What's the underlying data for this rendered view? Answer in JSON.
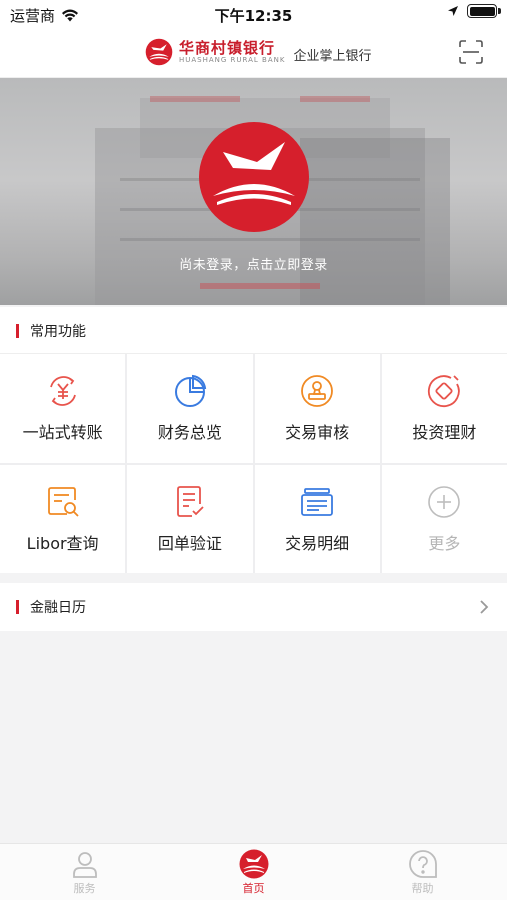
{
  "status_bar": {
    "carrier": "运营商",
    "time": "下午12:35"
  },
  "header": {
    "brand_cn": "华商村镇银行",
    "brand_en": "HUASHANG RURAL BANK",
    "subtitle": "企业掌上银行",
    "scan_icon": "scan-icon"
  },
  "banner": {
    "login_prompt": "尚未登录，点击立即登录"
  },
  "common_functions": {
    "title": "常用功能",
    "items": [
      {
        "label": "一站式转账",
        "icon": "transfer-icon",
        "color": "#e8544c"
      },
      {
        "label": "财务总览",
        "icon": "pie-chart-icon",
        "color": "#3a7be0"
      },
      {
        "label": "交易审核",
        "icon": "stamp-icon",
        "color": "#f08a24"
      },
      {
        "label": "投资理财",
        "icon": "investment-icon",
        "color": "#e8544c"
      },
      {
        "label": "Libor查询",
        "icon": "search-doc-icon",
        "color": "#f08a24"
      },
      {
        "label": "回单验证",
        "icon": "receipt-check-icon",
        "color": "#e8544c"
      },
      {
        "label": "交易明细",
        "icon": "card-list-icon",
        "color": "#3a7be0"
      },
      {
        "label": "更多",
        "icon": "plus-icon",
        "color": "#bdbdbd"
      }
    ]
  },
  "financial_calendar": {
    "title": "金融日历"
  },
  "tabbar": {
    "tabs": [
      {
        "label": "服务",
        "icon": "person-icon",
        "active": false
      },
      {
        "label": "首页",
        "icon": "bank-logo-icon",
        "active": true
      },
      {
        "label": "帮助",
        "icon": "help-icon",
        "active": false
      }
    ]
  },
  "colors": {
    "brand_red": "#d61f2c",
    "accent_blue": "#3a7be0",
    "accent_orange": "#f08a24"
  }
}
